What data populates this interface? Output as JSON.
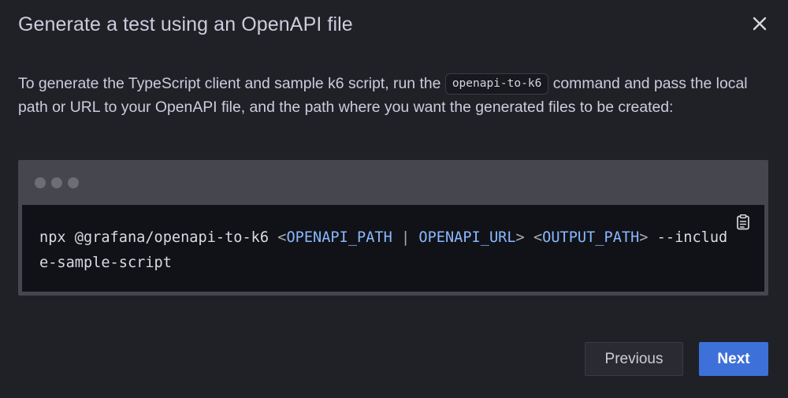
{
  "dialog": {
    "title": "Generate a test using an OpenAPI file",
    "close_icon": "close-icon"
  },
  "description": {
    "text_before": "To generate the TypeScript client and sample k6 script, run the ",
    "inline_code": "openapi-to-k6",
    "text_after": " command and pass the local path or URL to your OpenAPI file, and the path where you want the generated files to be created:"
  },
  "code_block": {
    "window_dots": [
      "dot-1",
      "dot-2",
      "dot-3"
    ],
    "copy_icon": "clipboard-icon",
    "command": {
      "prefix": "npx @grafana/openapi-to-k6 ",
      "lt1": "<",
      "var1": "OPENAPI_PATH",
      "sep": " | ",
      "var2": "OPENAPI_URL",
      "gt1": ">",
      "space1": " ",
      "lt2": "<",
      "var3": "OUTPUT_PATH",
      "gt2": ">",
      "suffix": " --include-sample-script"
    }
  },
  "footer": {
    "previous_label": "Previous",
    "next_label": "Next"
  },
  "colors": {
    "background": "#202127",
    "primary_button": "#3d71d9",
    "code_variable": "#8ab8ff"
  }
}
